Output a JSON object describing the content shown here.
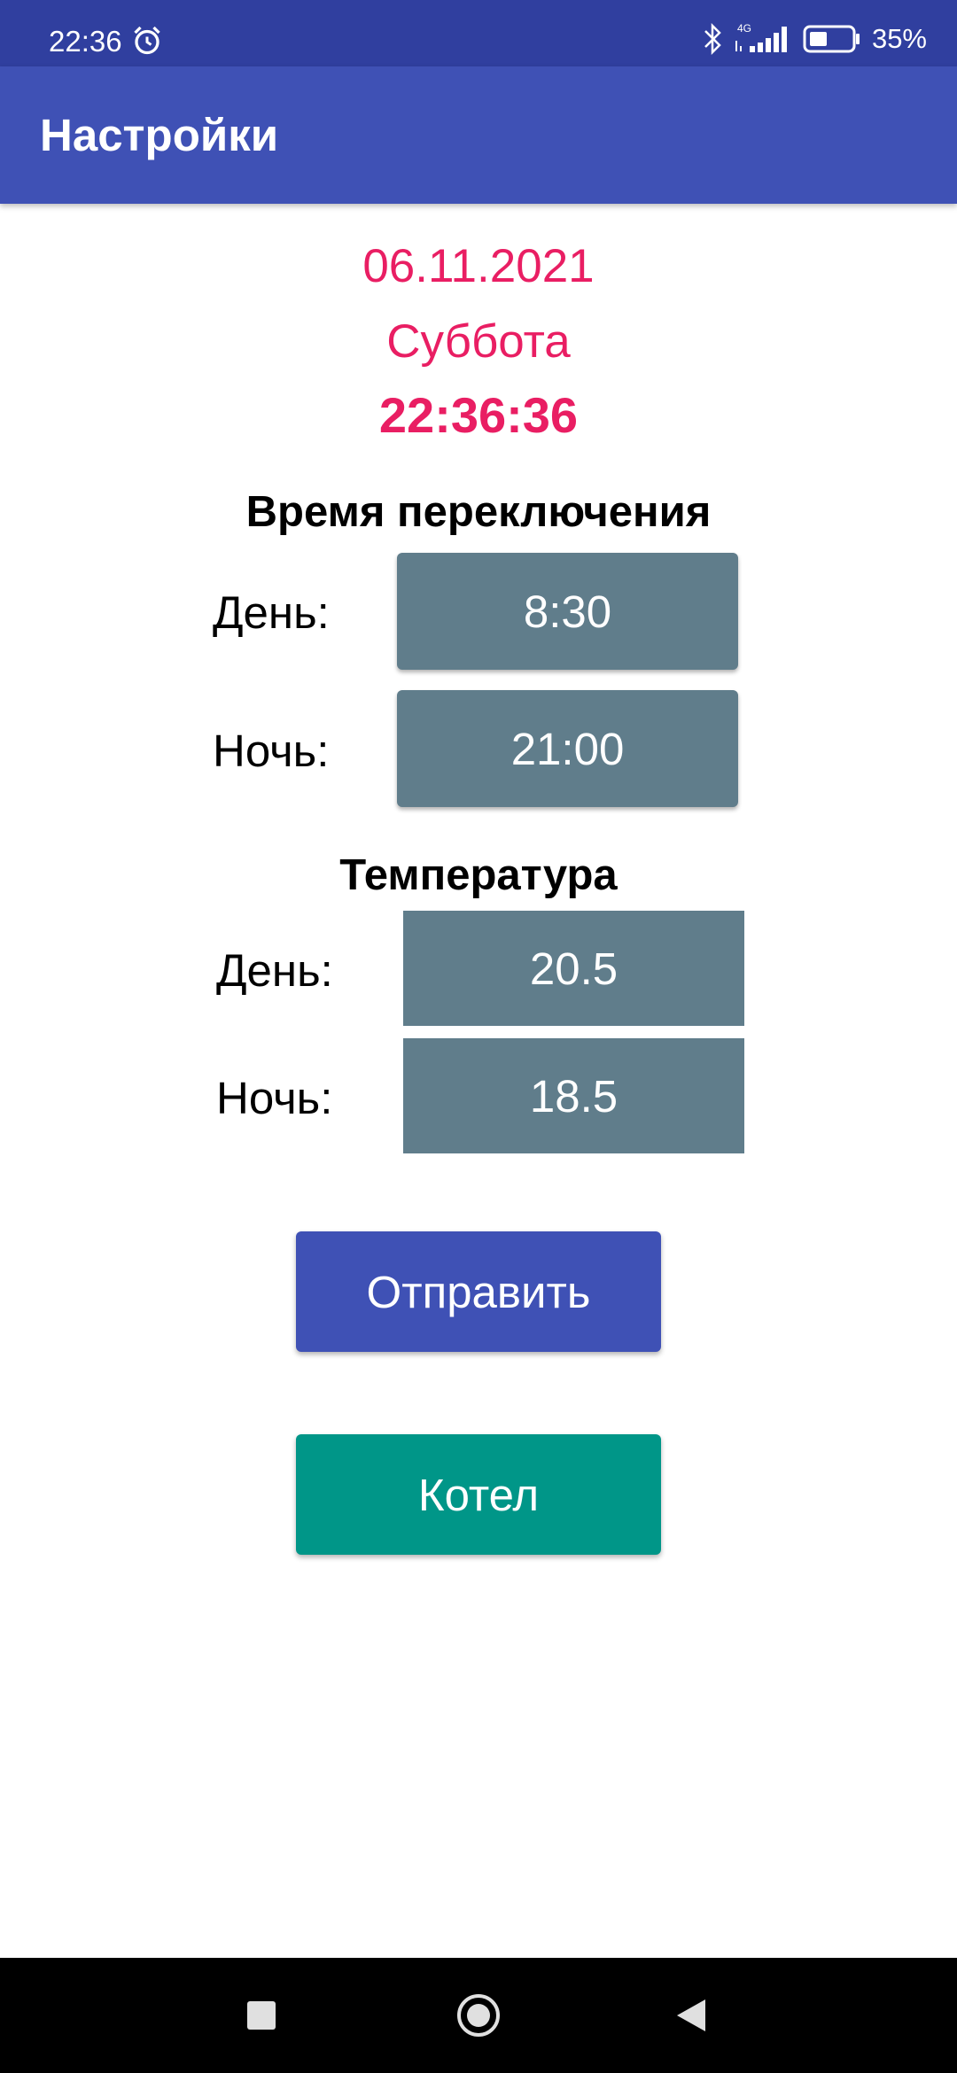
{
  "status_bar": {
    "time": "22:36",
    "network": "4G",
    "battery_percent": "35%",
    "icons": [
      "alarm-icon",
      "bluetooth-icon",
      "signal-icon",
      "battery-icon"
    ]
  },
  "app_bar": {
    "title": "Настройки"
  },
  "datetime": {
    "date": "06.11.2021",
    "weekday": "Суббота",
    "time": "22:36:36"
  },
  "switch_time": {
    "title": "Время переключения",
    "day_label": "День:",
    "day_value": "8:30",
    "night_label": "Ночь:",
    "night_value": "21:00"
  },
  "temperature": {
    "title": "Температура",
    "day_label": "День:",
    "day_value": "20.5",
    "night_label": "Ночь:",
    "night_value": "18.5"
  },
  "buttons": {
    "send": "Отправить",
    "boiler": "Котел"
  },
  "nav": {
    "icons": [
      "recents-icon",
      "home-icon",
      "back-icon"
    ]
  },
  "colors": {
    "status_bar": "#303f9f",
    "app_bar": "#3f51b5",
    "accent_pink": "#e91e63",
    "field_bg": "#607d8b",
    "send_button": "#3f51b5",
    "boiler_button": "#009688"
  }
}
